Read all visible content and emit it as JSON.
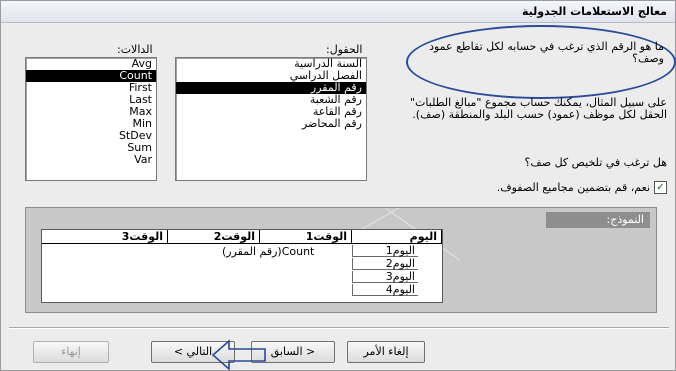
{
  "window": {
    "title": "معالج الاستعلامات الجدولية"
  },
  "help": {
    "question": "ما هو الرقم الذي ترغب في حسابه لكل تقاطع عمود وصف؟",
    "example": "على سبيل المثال، يمكنك حساب مجموع \"مبالغ الطلبات\" الحقل لكل موظف (عمود) حسب البلد والمنطقة (صف).",
    "summary_question": "هل ترغب في تلخيص كل صف؟"
  },
  "fields": {
    "label": "الحقول:",
    "items": [
      "السنة الدراسية",
      "الفصل الدراسي",
      "رقم المقرر",
      "رقم الشعبة",
      "رقم القاعة",
      "رقم المحاضر"
    ],
    "selected": "رقم المقرر"
  },
  "functions": {
    "label": "الدالات:",
    "items": [
      "Avg",
      "Count",
      "First",
      "Last",
      "Max",
      "Min",
      "StDev",
      "Sum",
      "Var"
    ],
    "selected": "Count"
  },
  "checkbox": {
    "label": "نعم، قم بتضمين مجاميع الصفوف.",
    "checked": true,
    "mark": "✓"
  },
  "sample": {
    "label": "النموذج:",
    "columns": [
      "اليوم",
      "الوقت1",
      "الوقت2",
      "الوقت3"
    ],
    "rows": [
      "اليوم1",
      "اليوم2",
      "اليوم3",
      "اليوم4"
    ],
    "cell": "Count(رقم المقرر)"
  },
  "buttons": {
    "cancel": "إلغاء الأمر",
    "back": "< السابق",
    "next": "التالي >",
    "finish": "إنهاء"
  }
}
